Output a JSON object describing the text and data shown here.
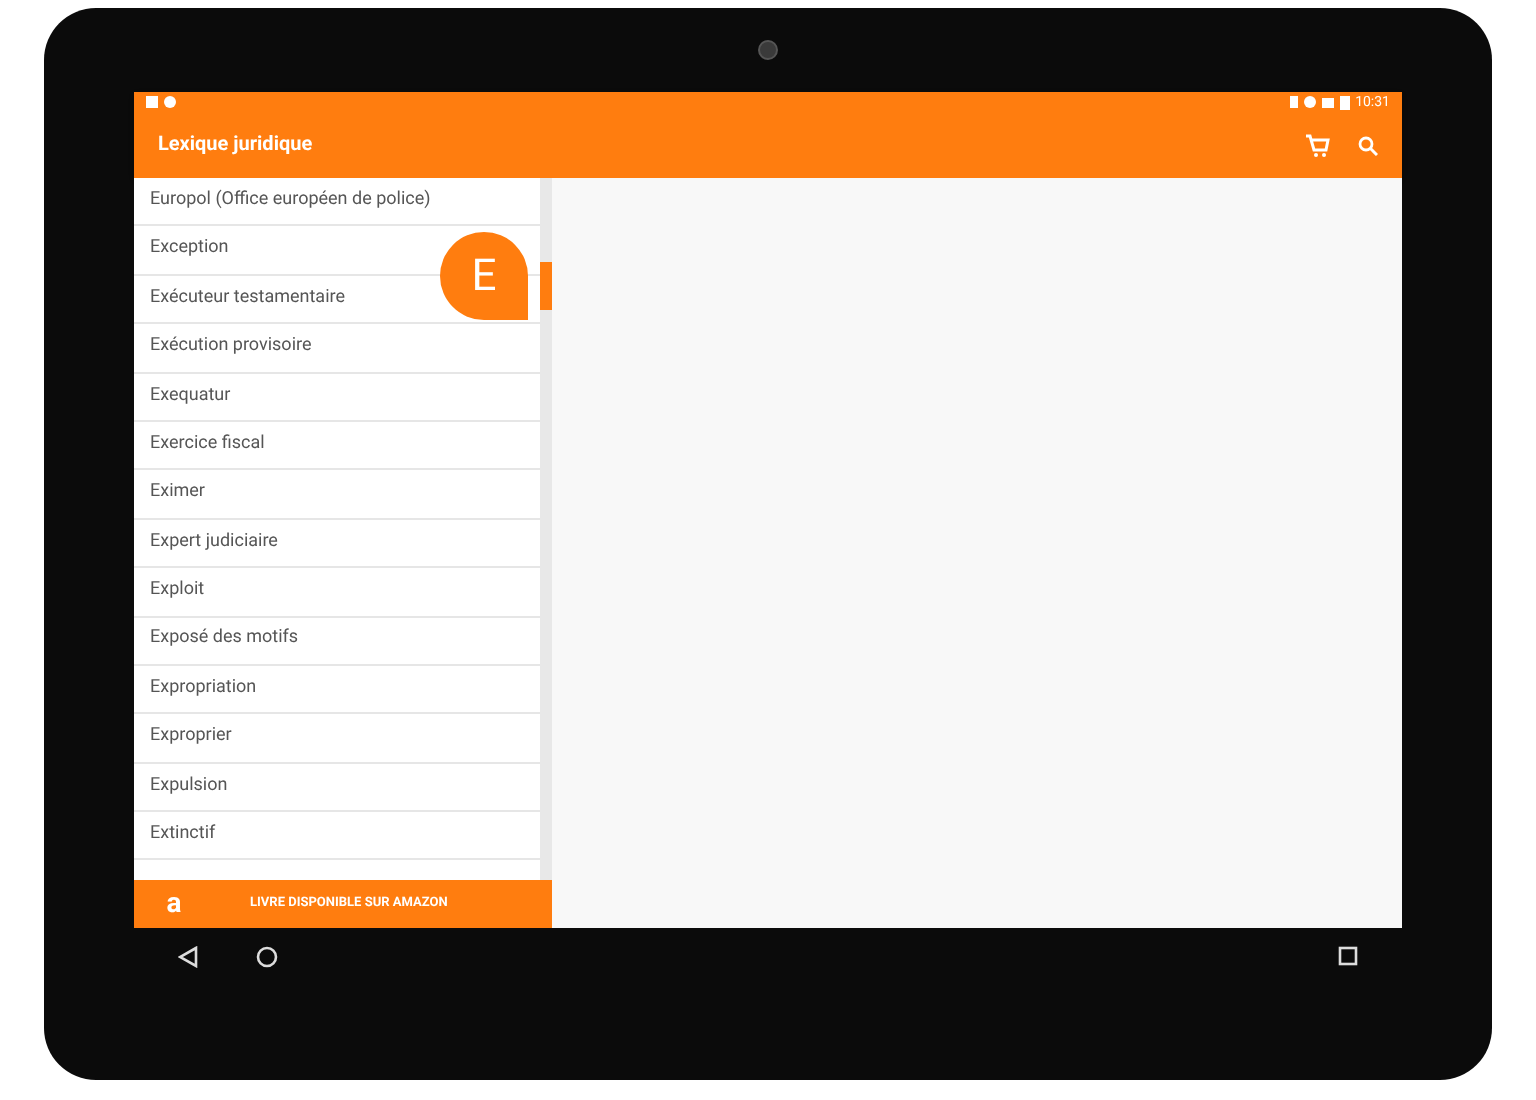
{
  "status_bar": {
    "time": "10:31"
  },
  "app_bar": {
    "title": "Lexique juridique"
  },
  "list": {
    "items": [
      "Europol (Office européen de police)",
      "Exception",
      "Exécuteur testamentaire",
      "Exécution provisoire",
      "Exequatur",
      "Exercice fiscal",
      "Eximer",
      "Expert judiciaire",
      "Exploit",
      "Exposé des motifs",
      "Expropriation",
      "Exproprier",
      "Expulsion",
      "Extinctif"
    ],
    "index_letter": "E",
    "scroll": {
      "level": 0.12
    }
  },
  "banner": {
    "text": "LIVRE DISPONIBLE SUR AMAZON",
    "logo": "a"
  }
}
